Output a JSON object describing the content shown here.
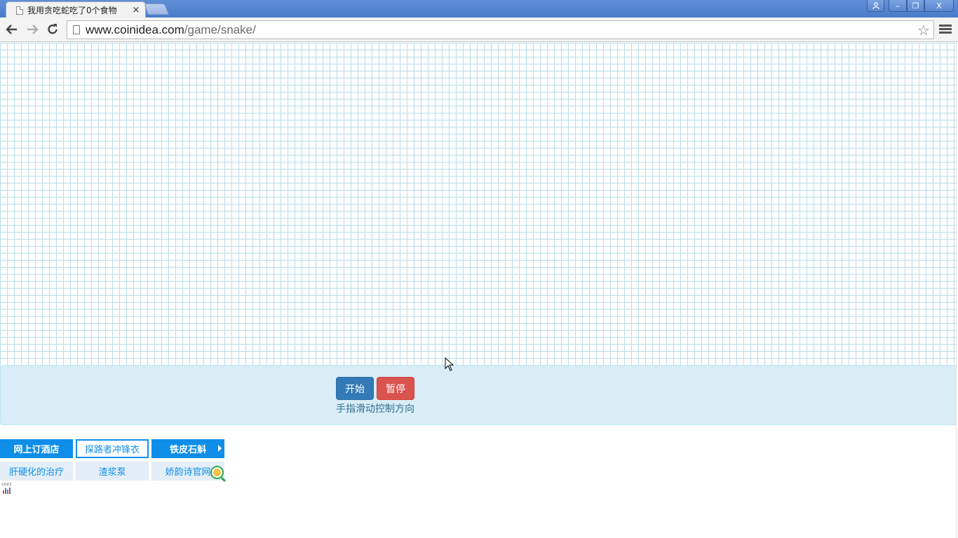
{
  "browser": {
    "tab_title": "我用贪吃蛇吃了0个食物",
    "tab_close": "×",
    "url_host": "www.coinidea.com",
    "url_path": "/game/snake/",
    "window_controls": {
      "minimize": "–",
      "maximize": "❐",
      "close": "X"
    }
  },
  "game": {
    "start_label": "开始",
    "pause_label": "暂停",
    "hint": "手指滑动控制方向"
  },
  "ads": {
    "row1": [
      "网上订酒店",
      "探路者冲锋衣",
      "铁皮石斛"
    ],
    "row2": [
      "肝硬化的治疗",
      "渣浆泵",
      "娇韵诗官网"
    ]
  },
  "stats_badge": "cnzz",
  "colors": {
    "grid_line": "#b9dde6",
    "panel_bg": "#d9edf7",
    "start_button": "#337ab7",
    "pause_button": "#d9534f",
    "ad_blue": "#0e8ee8"
  }
}
